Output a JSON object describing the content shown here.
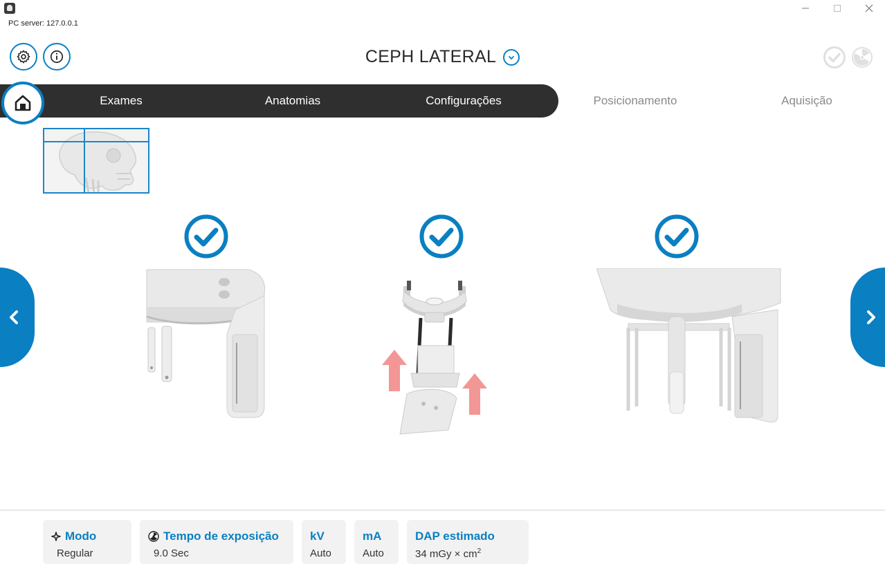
{
  "window": {
    "server_label": "PC server: 127.0.0.1",
    "controls": [
      "minimize-icon",
      "maximize-icon",
      "close-icon"
    ]
  },
  "header": {
    "exam_title": "CEPH LATERAL",
    "accent_color": "#0a7fc2"
  },
  "nav": {
    "tabs": [
      {
        "label": "Exames",
        "state": "done"
      },
      {
        "label": "Anatomias",
        "state": "done"
      },
      {
        "label": "Configurações",
        "state": "done"
      },
      {
        "label": "Posicionamento",
        "state": "pending"
      },
      {
        "label": "Aquisição",
        "state": "pending"
      }
    ]
  },
  "steps": [
    {
      "status": "checked",
      "image": "ceph-arm-illustration"
    },
    {
      "status": "checked",
      "image": "head-support-raise-illustration"
    },
    {
      "status": "checked",
      "image": "ear-rods-illustration"
    }
  ],
  "params": {
    "modo": {
      "label": "Modo",
      "value": "Regular",
      "icon": "sparkle-icon"
    },
    "tempo": {
      "label": "Tempo de exposição",
      "value": "9.0 Sec",
      "icon": "radiation-icon"
    },
    "kv": {
      "label": "kV",
      "value": "Auto"
    },
    "ma": {
      "label": "mA",
      "value": "Auto"
    },
    "dap": {
      "label": "DAP estimado",
      "value": "34 mGy × cm",
      "unit_exp": "2"
    }
  }
}
